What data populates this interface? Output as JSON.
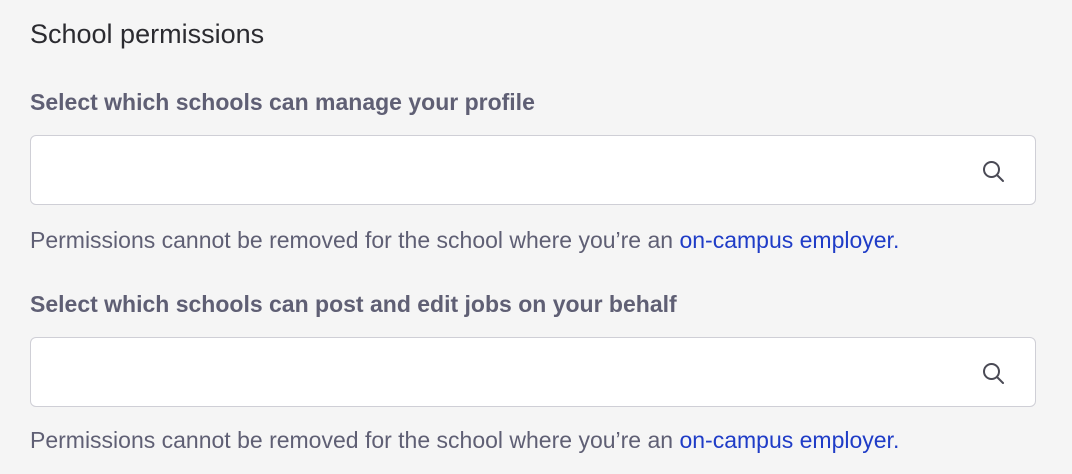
{
  "section": {
    "title": "School permissions"
  },
  "fields": [
    {
      "label": "Select which schools can manage your profile",
      "value": "",
      "placeholder": "",
      "icon": "search-icon",
      "helper_text": "Permissions cannot be removed for the school where you’re an ",
      "helper_link": "on-campus employer."
    },
    {
      "label": "Select which schools can post and edit jobs on your behalf",
      "value": "",
      "placeholder": "",
      "icon": "search-icon",
      "helper_text": "Permissions cannot be removed for the school where you’re an ",
      "helper_link": "on-campus employer."
    }
  ],
  "colors": {
    "background": "#f5f5f5",
    "link": "#1f3cc7",
    "label": "#5f5f74",
    "title": "#2b2b30"
  }
}
